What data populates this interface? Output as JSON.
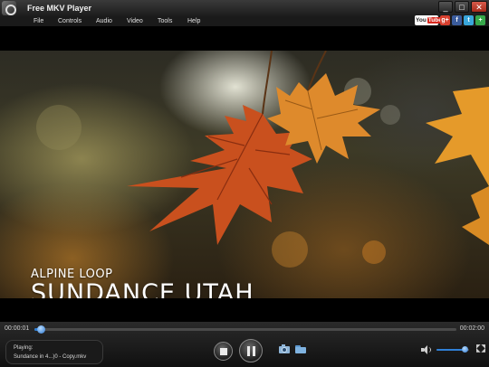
{
  "window": {
    "title": "Free MKV Player",
    "minimize": "_",
    "maximize": "□",
    "close": "✕"
  },
  "menu": {
    "items": [
      {
        "label": "File"
      },
      {
        "label": "Controls"
      },
      {
        "label": "Audio"
      },
      {
        "label": "Video"
      },
      {
        "label": "Tools"
      },
      {
        "label": "Help"
      }
    ]
  },
  "social": {
    "youtube_you": "You",
    "youtube_tube": "Tube",
    "googleplus": "g+",
    "facebook": "f",
    "twitter": "t",
    "share": "+"
  },
  "video": {
    "caption_small": "ALPINE LOOP",
    "caption_big": "SUNDANCE UTAH"
  },
  "playback": {
    "elapsed": "00:00:01",
    "total": "00:02:00",
    "progress_fraction": 0.01,
    "volume_fraction": 0.85
  },
  "now_playing": {
    "label": "Playing:",
    "file": "Sundance in 4...)0 - Copy.mkv"
  },
  "colors": {
    "accent": "#2f7fd6",
    "leaf_orange": "#d9762a",
    "leaf_red": "#c2471c"
  },
  "icons": {
    "stop": "stop-icon",
    "pause": "pause-icon",
    "snapshot": "camera-icon",
    "open": "folder-icon",
    "mute": "speaker-icon",
    "fullscreen": "fullscreen-icon"
  }
}
